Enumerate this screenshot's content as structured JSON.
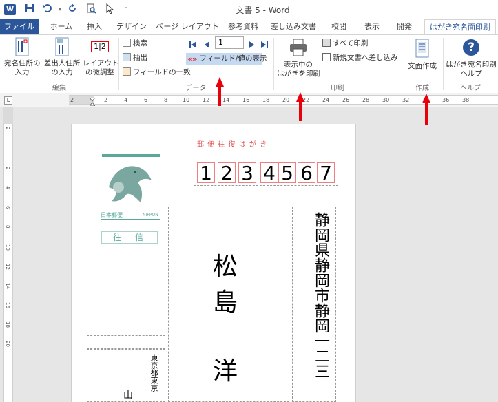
{
  "title_bar": {
    "app_icon": "W",
    "title": "文書 5 - Word"
  },
  "tabs": [
    "ファイル",
    "ホーム",
    "挿入",
    "デザイン",
    "ページ レイアウト",
    "参考資料",
    "差し込み文書",
    "校閲",
    "表示",
    "開発",
    "はがき宛名面印刷"
  ],
  "ribbon": {
    "edit_group": {
      "label": "編集",
      "btn1": [
        "宛名住所の",
        "入力"
      ],
      "btn2": [
        "差出人住所",
        "の入力"
      ],
      "btn3": [
        "レイアウト",
        "の微調整"
      ],
      "layout_icon_text": "1|2"
    },
    "data_group": {
      "label": "データ",
      "search": "検索",
      "extract": "抽出",
      "field_match": "フィールドの一致",
      "record_value": "1",
      "field_toggle": "フィールド/値の表示"
    },
    "print_group": {
      "label": "印刷",
      "print_current": [
        "表示中の",
        "はがきを印刷"
      ],
      "print_all": "すべて印刷",
      "merge_new": "新規文書へ差し込み"
    },
    "create_group": {
      "label": "作成",
      "create_doc": "文面作成"
    },
    "help_group": {
      "label": "ヘルプ",
      "help_btn": [
        "はがき宛名印刷",
        "ヘルプ"
      ]
    }
  },
  "ruler": {
    "numbers": [
      "2",
      "2",
      "4",
      "6",
      "8",
      "10",
      "12",
      "14",
      "16",
      "18",
      "20",
      "22",
      "24",
      "26",
      "28",
      "30",
      "32",
      "34",
      "36",
      "38"
    ],
    "vnumbers": [
      "2",
      "2",
      "4",
      "6",
      "8",
      "10",
      "12",
      "14",
      "16",
      "18",
      "20"
    ],
    "tab_symbol": "L"
  },
  "postcard": {
    "header": "郵 便 往 復 は が き",
    "stamp_brand": "日本郵便",
    "stamp_label": "NIPPON",
    "return_mark": "往　信",
    "postal_digits": [
      "1",
      "2",
      "3",
      "4",
      "5",
      "6",
      "7"
    ],
    "recipient_name": [
      "松",
      "島",
      "",
      "洋"
    ],
    "recipient_address": "静岡県静岡市静岡一二三",
    "sender_address": "東京都東京",
    "sender_name": "山"
  },
  "colors": {
    "accent": "#2b579a",
    "postal_red": "#f08080",
    "arrow_red": "#e8000b"
  }
}
